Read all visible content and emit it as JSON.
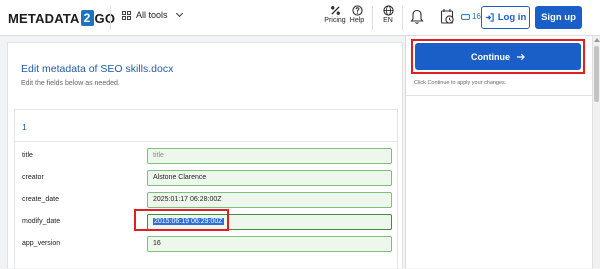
{
  "header": {
    "logo_part1": "METADATA",
    "logo_two": "2",
    "logo_part2": "GO",
    "all_tools_label": "All tools",
    "pricing_label": "Pricing",
    "help_label": "Help",
    "language_label": "EN",
    "credits_count": "16",
    "login_label": "Log in",
    "signup_label": "Sign up"
  },
  "main": {
    "title": "Edit metadata of SEO skills.docx",
    "subtitle": "Edit the fields below as needed.",
    "card_number": "1",
    "fields": [
      {
        "label": "title",
        "value": "",
        "placeholder": "title"
      },
      {
        "label": "creator",
        "value": "Alstone Clarence"
      },
      {
        "label": "create_date",
        "value": "2025:01:17 06:28:00Z"
      },
      {
        "label": "modify_date",
        "value": "2015:06:19 06:29:00Z"
      },
      {
        "label": "app_version",
        "value": "16"
      }
    ]
  },
  "side": {
    "continue_label": "Continue",
    "hint": "Click Continue to apply your changes."
  },
  "colors": {
    "primary": "#1a5fc8",
    "highlight_box": "#e0201f",
    "field_border": "#7cc07c",
    "field_bg": "#eef7ec"
  },
  "icons": [
    "grid-icon",
    "chevron-down-icon",
    "pricing-icon",
    "help-icon",
    "globe-icon",
    "bell-icon",
    "clock-icon",
    "credits-icon",
    "login-icon",
    "arrow-right-icon"
  ]
}
